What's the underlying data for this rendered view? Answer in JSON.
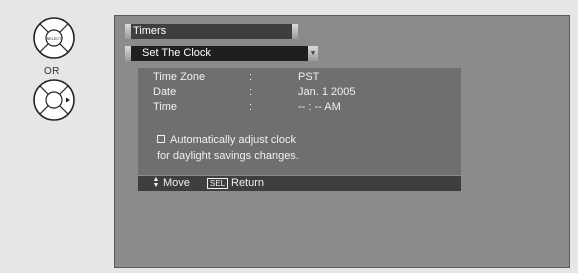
{
  "remote": {
    "select_key_label": "SELECT",
    "or_label": "OR"
  },
  "menu": {
    "title": "Timers",
    "submenu": "Set The Clock"
  },
  "clock": {
    "rows": [
      {
        "label": "Time Zone",
        "separator": ":",
        "value": "PST"
      },
      {
        "label": "Date",
        "separator": ":",
        "value": "Jan. 1 2005"
      },
      {
        "label": "Time",
        "separator": ":",
        "value": "-- : -- AM"
      }
    ],
    "dst_option_line1": "Automatically adjust clock",
    "dst_option_line2": "for daylight savings changes.",
    "dst_checked": false
  },
  "guide": {
    "move_label": "Move",
    "sel_key": "SEL",
    "return_label": "Return"
  },
  "colors": {
    "screen_bg": "#8b8b8b",
    "title_bar": "#3e3e3e",
    "sub_bar": "#1f1f1f",
    "info_box": "#6f6f6f"
  }
}
